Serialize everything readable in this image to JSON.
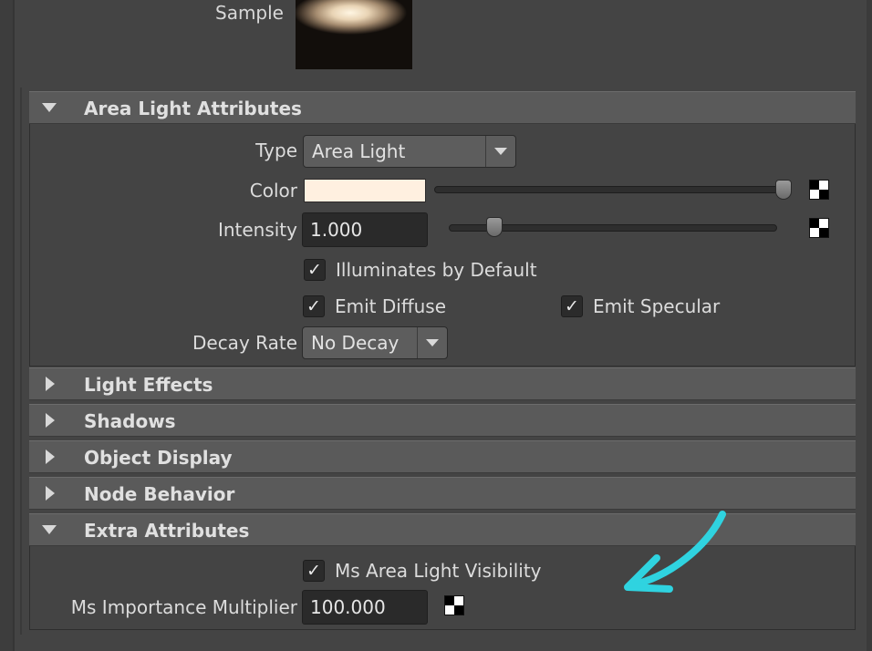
{
  "sample": {
    "label": "Sample"
  },
  "sections": {
    "area_light": {
      "title": "Area Light Attributes",
      "expanded": true
    },
    "light_effects": {
      "title": "Light Effects",
      "expanded": false
    },
    "shadows": {
      "title": "Shadows",
      "expanded": false
    },
    "object_display": {
      "title": "Object Display",
      "expanded": false
    },
    "node_behavior": {
      "title": "Node Behavior",
      "expanded": false
    },
    "extra_attributes": {
      "title": "Extra Attributes",
      "expanded": true
    }
  },
  "area_light": {
    "type": {
      "label": "Type",
      "value": "Area Light"
    },
    "color": {
      "label": "Color",
      "swatch_hex": "#fff0e0",
      "slider_fraction": 1.0
    },
    "intensity": {
      "label": "Intensity",
      "value": "1.000",
      "slider_fraction": 0.12
    },
    "illuminates_by_default": {
      "label": "Illuminates by Default",
      "checked": true
    },
    "emit_diffuse": {
      "label": "Emit Diffuse",
      "checked": true
    },
    "emit_specular": {
      "label": "Emit Specular",
      "checked": true
    },
    "decay_rate": {
      "label": "Decay Rate",
      "value": "No Decay"
    }
  },
  "extra": {
    "ms_area_light_visibility": {
      "label": "Ms Area Light Visibility",
      "checked": true
    },
    "ms_importance_multiplier": {
      "label": "Ms Importance Multiplier",
      "value": "100.000"
    }
  },
  "icons": {
    "expand": "triangle-down-icon",
    "collapse": "triangle-right-icon",
    "map_button": "checker-map-icon",
    "check": "checkmark-icon",
    "annotation": "cyan-arrow-icon"
  },
  "colors": {
    "panel_bg": "#444444",
    "header_bg": "#5a5a5a",
    "field_bg": "#2a2a2a",
    "annotation_arrow": "#2fd3e0"
  }
}
